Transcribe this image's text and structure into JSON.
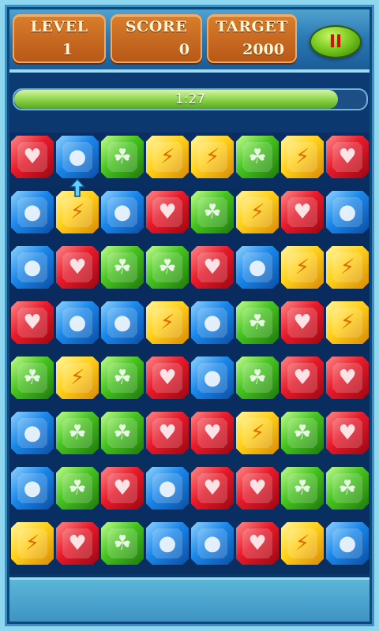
{
  "hud": {
    "level_label": "LEVEL",
    "level_value": "1",
    "score_label": "SCORE",
    "score_value": "0",
    "target_label": "TARGET",
    "target_value": "2000",
    "pause_symbol": "II"
  },
  "timer": {
    "text": "1:27",
    "fill_fraction": 0.92
  },
  "board": {
    "rows": [
      [
        "red",
        "blue",
        "green",
        "yellow",
        "yellow",
        "green",
        "yellow",
        "red"
      ],
      [
        "blue",
        "yellow",
        "blue",
        "red",
        "green",
        "yellow",
        "red",
        "blue"
      ],
      [
        "blue",
        "red",
        "green",
        "green",
        "red",
        "blue",
        "yellow",
        "yellow"
      ],
      [
        "red",
        "blue",
        "blue",
        "yellow",
        "blue",
        "green",
        "red",
        "yellow"
      ],
      [
        "green",
        "yellow",
        "green",
        "red",
        "blue",
        "green",
        "red",
        "red"
      ],
      [
        "blue",
        "green",
        "green",
        "red",
        "red",
        "yellow",
        "green",
        "red"
      ],
      [
        "blue",
        "green",
        "red",
        "blue",
        "red",
        "red",
        "green",
        "green"
      ],
      [
        "yellow",
        "red",
        "green",
        "blue",
        "blue",
        "red",
        "yellow",
        "blue"
      ]
    ],
    "hint": {
      "row": 1,
      "col": 1,
      "direction": "up"
    }
  },
  "gem_icons": {
    "red": "heart-icon",
    "blue": "water-drop-icon",
    "green": "leaf-icon",
    "yellow": "lightning-icon"
  },
  "colors": {
    "red": "#e51a2a",
    "blue": "#1a86e8",
    "green": "#45c21f",
    "yellow": "#ffd11a",
    "hint_arrow": "#5fd0ff"
  }
}
